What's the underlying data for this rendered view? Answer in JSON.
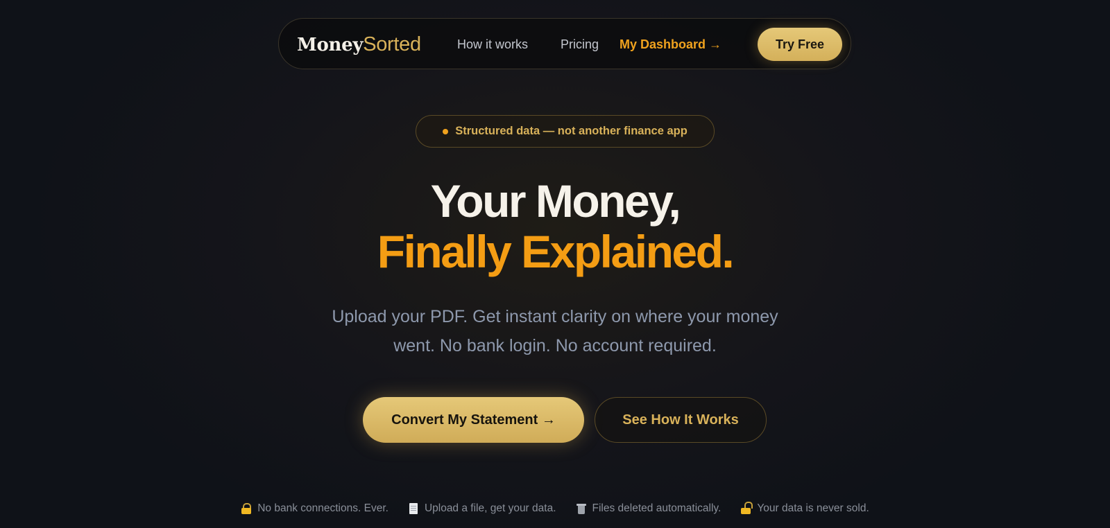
{
  "nav": {
    "logo_part1": "Money",
    "logo_part2": "Sorted",
    "links": [
      {
        "label": "How it works"
      },
      {
        "label": "Pricing"
      },
      {
        "label": "My Dashboard →"
      }
    ],
    "try_label": "Try Free"
  },
  "badge": {
    "text": "Structured data — not another finance app"
  },
  "hero": {
    "title_line1": "Your Money,",
    "title_line2": "Finally Explained.",
    "subtitle": "Upload your PDF. Get instant clarity on where your money went. No bank login. No account required.",
    "primary_cta": "Convert My Statement →",
    "secondary_cta": "See How It Works"
  },
  "trust": [
    {
      "icon": "lock-icon",
      "text": "No bank connections. Ever."
    },
    {
      "icon": "document-icon",
      "text": "Upload a file, get your data."
    },
    {
      "icon": "trash-icon",
      "text": "Files deleted automatically."
    },
    {
      "icon": "open-lock-icon",
      "text": "Your data is never sold."
    }
  ],
  "colors": {
    "accent_gold": "#d9b25a",
    "accent_orange": "#f49d14",
    "background": "#15151a"
  }
}
